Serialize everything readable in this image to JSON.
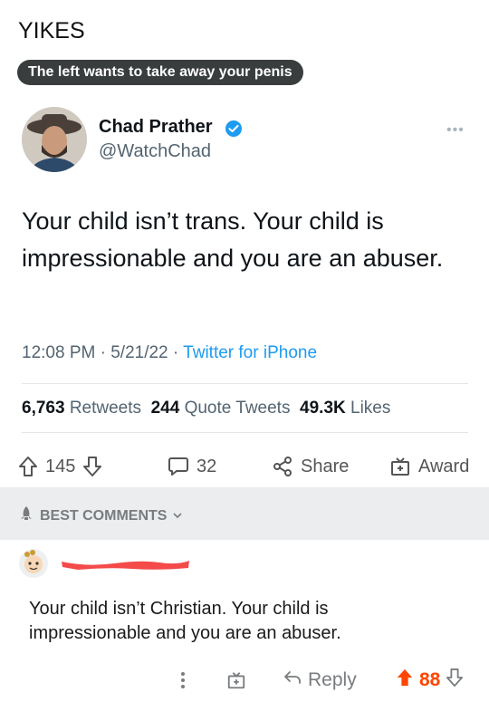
{
  "post": {
    "title": "YIKES",
    "flair": "The left wants to take away your penis"
  },
  "tweet": {
    "name": "Chad Prather",
    "handle": "@WatchChad",
    "text": "Your child isn’t trans. Your child is impressionable and you are an abuser.",
    "time": "12:08 PM",
    "date": "5/21/22",
    "source": "Twitter for iPhone",
    "retweets_count": "6,763",
    "retweets_label": "Retweets",
    "quotes_count": "244",
    "quotes_label": "Quote Tweets",
    "likes_count": "49.3K",
    "likes_label": "Likes"
  },
  "actions": {
    "votes": "145",
    "comments": "32",
    "share_label": "Share",
    "award_label": "Award"
  },
  "comments_section": {
    "sort_label": "BEST COMMENTS"
  },
  "comment": {
    "text": "Your child isn’t Christian. Your child is impressionable and you are an abuser.",
    "reply_label": "Reply",
    "votes": "88"
  },
  "colors": {
    "accent": "#1d9bf0",
    "upvote": "#ff4500",
    "flair_bg": "#3a3d3e"
  }
}
